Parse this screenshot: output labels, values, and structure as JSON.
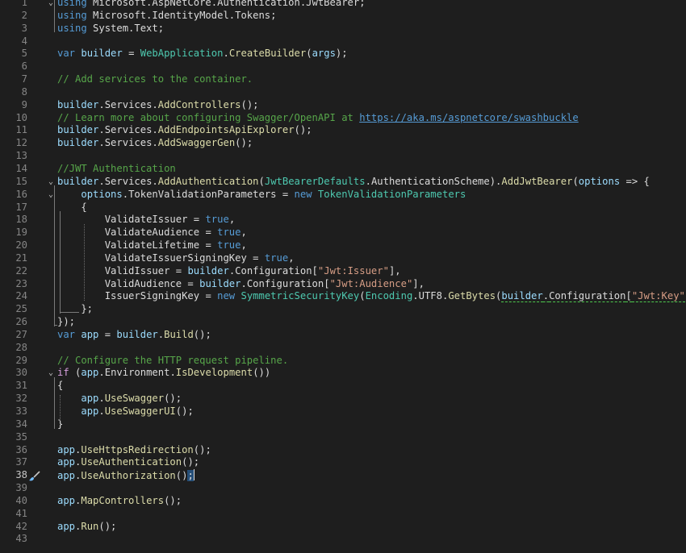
{
  "editor": {
    "current_line": 38,
    "lines": [
      {
        "n": "1",
        "tokens": [
          [
            "kw",
            "using"
          ],
          [
            "ns",
            " Microsoft.AspNetCore.Authentication.JwtBearer"
          ],
          [
            "p",
            ";"
          ]
        ]
      },
      {
        "n": "2",
        "tokens": [
          [
            "kw",
            "using"
          ],
          [
            "ns",
            " Microsoft.IdentityModel.Tokens"
          ],
          [
            "p",
            ";"
          ]
        ]
      },
      {
        "n": "3",
        "tokens": [
          [
            "kw",
            "using"
          ],
          [
            "ns",
            " System.Text"
          ],
          [
            "p",
            ";"
          ]
        ]
      },
      {
        "n": "4",
        "tokens": []
      },
      {
        "n": "5",
        "tokens": [
          [
            "kw",
            "var"
          ],
          [
            "p",
            " "
          ],
          [
            "local",
            "builder"
          ],
          [
            "p",
            " = "
          ],
          [
            "type",
            "WebApplication"
          ],
          [
            "p",
            "."
          ],
          [
            "method",
            "CreateBuilder"
          ],
          [
            "p",
            "("
          ],
          [
            "param",
            "args"
          ],
          [
            "p",
            ");"
          ]
        ]
      },
      {
        "n": "6",
        "tokens": []
      },
      {
        "n": "7",
        "tokens": [
          [
            "cmt",
            "// Add services to the container."
          ]
        ]
      },
      {
        "n": "8",
        "tokens": []
      },
      {
        "n": "9",
        "tokens": [
          [
            "local",
            "builder"
          ],
          [
            "p",
            "."
          ],
          [
            "prop",
            "Services"
          ],
          [
            "p",
            "."
          ],
          [
            "method",
            "AddControllers"
          ],
          [
            "p",
            "();"
          ]
        ]
      },
      {
        "n": "10",
        "tokens": [
          [
            "cmt",
            "// Learn more about configuring Swagger/OpenAPI at "
          ],
          [
            "link",
            "https://aka.ms/aspnetcore/swashbuckle"
          ]
        ]
      },
      {
        "n": "11",
        "tokens": [
          [
            "local",
            "builder"
          ],
          [
            "p",
            "."
          ],
          [
            "prop",
            "Services"
          ],
          [
            "p",
            "."
          ],
          [
            "method",
            "AddEndpointsApiExplorer"
          ],
          [
            "p",
            "();"
          ]
        ]
      },
      {
        "n": "12",
        "tokens": [
          [
            "local",
            "builder"
          ],
          [
            "p",
            "."
          ],
          [
            "prop",
            "Services"
          ],
          [
            "p",
            "."
          ],
          [
            "method",
            "AddSwaggerGen"
          ],
          [
            "p",
            "();"
          ]
        ]
      },
      {
        "n": "13",
        "tokens": []
      },
      {
        "n": "14",
        "tokens": [
          [
            "cmt",
            "//JWT Authentication"
          ]
        ]
      },
      {
        "n": "15",
        "tokens": [
          [
            "local",
            "builder"
          ],
          [
            "p",
            "."
          ],
          [
            "prop",
            "Services"
          ],
          [
            "p",
            "."
          ],
          [
            "method",
            "AddAuthentication"
          ],
          [
            "p",
            "("
          ],
          [
            "type",
            "JwtBearerDefaults"
          ],
          [
            "p",
            "."
          ],
          [
            "prop",
            "AuthenticationScheme"
          ],
          [
            "p",
            ")."
          ],
          [
            "method",
            "AddJwtBearer"
          ],
          [
            "p",
            "("
          ],
          [
            "param",
            "options"
          ],
          [
            "p",
            " => {"
          ]
        ]
      },
      {
        "n": "16",
        "tokens": [
          [
            "p",
            "    "
          ],
          [
            "param",
            "options"
          ],
          [
            "p",
            "."
          ],
          [
            "prop",
            "TokenValidationParameters"
          ],
          [
            "p",
            " = "
          ],
          [
            "kw",
            "new"
          ],
          [
            "p",
            " "
          ],
          [
            "type",
            "TokenValidationParameters"
          ]
        ]
      },
      {
        "n": "17",
        "tokens": [
          [
            "p",
            "    {"
          ]
        ]
      },
      {
        "n": "18",
        "tokens": [
          [
            "p",
            "        "
          ],
          [
            "prop",
            "ValidateIssuer"
          ],
          [
            "p",
            " = "
          ],
          [
            "kw",
            "true"
          ],
          [
            "p",
            ","
          ]
        ]
      },
      {
        "n": "19",
        "tokens": [
          [
            "p",
            "        "
          ],
          [
            "prop",
            "ValidateAudience"
          ],
          [
            "p",
            " = "
          ],
          [
            "kw",
            "true"
          ],
          [
            "p",
            ","
          ]
        ]
      },
      {
        "n": "20",
        "tokens": [
          [
            "p",
            "        "
          ],
          [
            "prop",
            "ValidateLifetime"
          ],
          [
            "p",
            " = "
          ],
          [
            "kw",
            "true"
          ],
          [
            "p",
            ","
          ]
        ]
      },
      {
        "n": "21",
        "tokens": [
          [
            "p",
            "        "
          ],
          [
            "prop",
            "ValidateIssuerSigningKey"
          ],
          [
            "p",
            " = "
          ],
          [
            "kw",
            "true"
          ],
          [
            "p",
            ","
          ]
        ]
      },
      {
        "n": "22",
        "tokens": [
          [
            "p",
            "        "
          ],
          [
            "prop",
            "ValidIssuer"
          ],
          [
            "p",
            " = "
          ],
          [
            "local",
            "builder"
          ],
          [
            "p",
            "."
          ],
          [
            "prop",
            "Configuration"
          ],
          [
            "p",
            "["
          ],
          [
            "str",
            "\"Jwt:Issuer\""
          ],
          [
            "p",
            "],"
          ]
        ]
      },
      {
        "n": "23",
        "tokens": [
          [
            "p",
            "        "
          ],
          [
            "prop",
            "ValidAudience"
          ],
          [
            "p",
            " = "
          ],
          [
            "local",
            "builder"
          ],
          [
            "p",
            "."
          ],
          [
            "prop",
            "Configuration"
          ],
          [
            "p",
            "["
          ],
          [
            "str",
            "\"Jwt:Audience\""
          ],
          [
            "p",
            "],"
          ]
        ]
      },
      {
        "n": "24",
        "tokens": [
          [
            "p",
            "        "
          ],
          [
            "prop",
            "IssuerSigningKey"
          ],
          [
            "p",
            " = "
          ],
          [
            "kw",
            "new"
          ],
          [
            "p",
            " "
          ],
          [
            "type",
            "SymmetricSecurityKey"
          ],
          [
            "p",
            "("
          ],
          [
            "type",
            "Encoding"
          ],
          [
            "p",
            "."
          ],
          [
            "prop",
            "UTF8"
          ],
          [
            "p",
            "."
          ],
          [
            "method",
            "GetBytes"
          ],
          [
            "p",
            "("
          ],
          [
            "sq_local",
            "builder"
          ],
          [
            "sq_p",
            "."
          ],
          [
            "sq_prop",
            "Configuration"
          ],
          [
            "sq_p",
            "["
          ],
          [
            "sq_str",
            "\"Jwt:Key\""
          ],
          [
            "p",
            "]))"
          ]
        ]
      },
      {
        "n": "25",
        "tokens": [
          [
            "p",
            "    };"
          ]
        ]
      },
      {
        "n": "26",
        "tokens": [
          [
            "p",
            "});"
          ]
        ]
      },
      {
        "n": "27",
        "tokens": [
          [
            "kw",
            "var"
          ],
          [
            "p",
            " "
          ],
          [
            "local",
            "app"
          ],
          [
            "p",
            " = "
          ],
          [
            "local",
            "builder"
          ],
          [
            "p",
            "."
          ],
          [
            "method",
            "Build"
          ],
          [
            "p",
            "();"
          ]
        ]
      },
      {
        "n": "28",
        "tokens": []
      },
      {
        "n": "29",
        "tokens": [
          [
            "cmt",
            "// Configure the HTTP request pipeline."
          ]
        ]
      },
      {
        "n": "30",
        "tokens": [
          [
            "ctl",
            "if"
          ],
          [
            "p",
            " ("
          ],
          [
            "local",
            "app"
          ],
          [
            "p",
            "."
          ],
          [
            "prop",
            "Environment"
          ],
          [
            "p",
            "."
          ],
          [
            "method",
            "IsDevelopment"
          ],
          [
            "p",
            "())"
          ]
        ]
      },
      {
        "n": "31",
        "tokens": [
          [
            "p",
            "{"
          ]
        ]
      },
      {
        "n": "32",
        "tokens": [
          [
            "p",
            "    "
          ],
          [
            "local",
            "app"
          ],
          [
            "p",
            "."
          ],
          [
            "method",
            "UseSwagger"
          ],
          [
            "p",
            "();"
          ]
        ]
      },
      {
        "n": "33",
        "tokens": [
          [
            "p",
            "    "
          ],
          [
            "local",
            "app"
          ],
          [
            "p",
            "."
          ],
          [
            "method",
            "UseSwaggerUI"
          ],
          [
            "p",
            "();"
          ]
        ]
      },
      {
        "n": "34",
        "tokens": [
          [
            "p",
            "}"
          ]
        ]
      },
      {
        "n": "35",
        "tokens": []
      },
      {
        "n": "36",
        "tokens": [
          [
            "local",
            "app"
          ],
          [
            "p",
            "."
          ],
          [
            "method",
            "UseHttpsRedirection"
          ],
          [
            "p",
            "();"
          ]
        ]
      },
      {
        "n": "37",
        "tokens": [
          [
            "local",
            "app"
          ],
          [
            "p",
            "."
          ],
          [
            "method",
            "UseAuthentication"
          ],
          [
            "p",
            "();"
          ]
        ]
      },
      {
        "n": "38",
        "tokens": [
          [
            "local",
            "app"
          ],
          [
            "p",
            "."
          ],
          [
            "method",
            "UseAuthorization"
          ],
          [
            "p",
            "()"
          ],
          [
            "sel",
            ";"
          ],
          [
            "caret",
            ""
          ]
        ]
      },
      {
        "n": "39",
        "tokens": []
      },
      {
        "n": "40",
        "tokens": [
          [
            "local",
            "app"
          ],
          [
            "p",
            "."
          ],
          [
            "method",
            "MapControllers"
          ],
          [
            "p",
            "();"
          ]
        ]
      },
      {
        "n": "41",
        "tokens": []
      },
      {
        "n": "42",
        "tokens": [
          [
            "local",
            "app"
          ],
          [
            "p",
            "."
          ],
          [
            "method",
            "Run"
          ],
          [
            "p",
            "();"
          ]
        ]
      },
      {
        "n": "43",
        "tokens": []
      }
    ]
  },
  "icons": {
    "quick_action": "paintbrush-icon",
    "fold_open": "chevron-down-icon"
  },
  "colors": {
    "background": "#1e1e1e",
    "keyword": "#569cd6",
    "type": "#4ec9b0",
    "method": "#dcdcaa",
    "comment": "#57a64a",
    "string": "#d69d85",
    "local": "#9cdcfe"
  }
}
